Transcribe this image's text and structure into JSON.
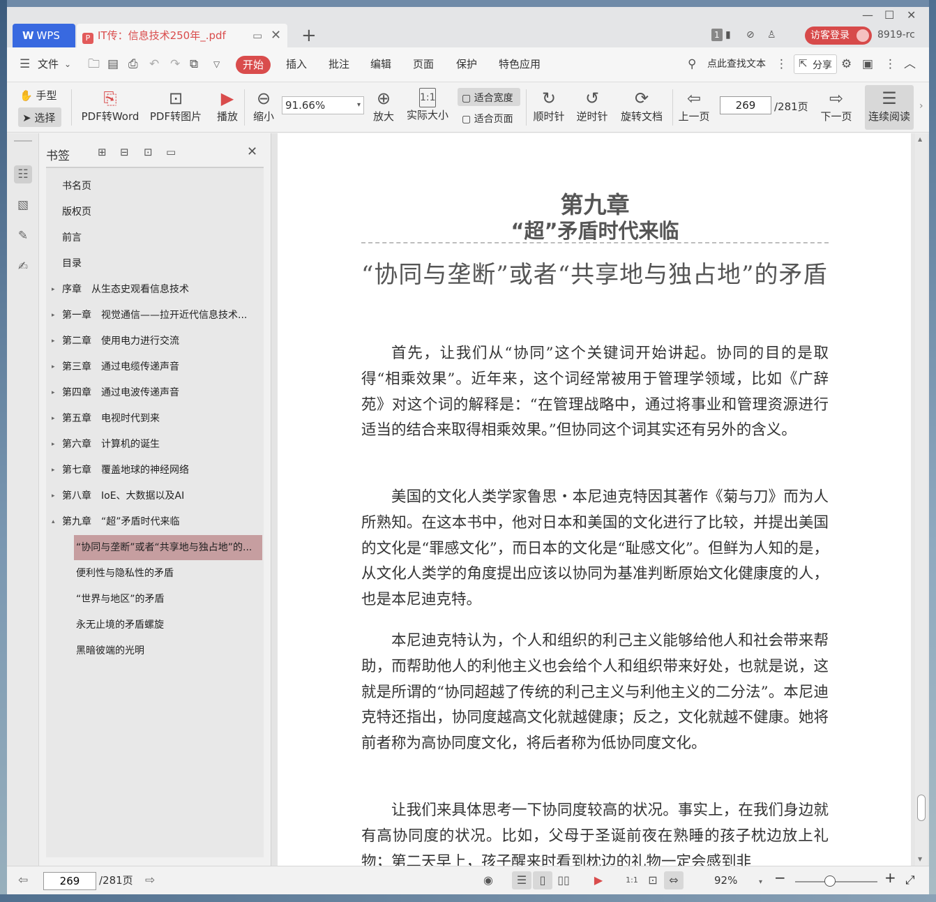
{
  "tabbar": {
    "app_label": "WPS",
    "doc_tab_title": "IT传：信息技术250年_.pdf",
    "page_badge": "1",
    "login_label": "访客登录",
    "user_label": "8919-rc"
  },
  "menubar": {
    "file_label": "文件",
    "tabs": [
      "开始",
      "插入",
      "批注",
      "编辑",
      "页面",
      "保护",
      "特色应用"
    ],
    "search_label": "点此查找文本",
    "share_label": "分享"
  },
  "toolbar": {
    "hand_label": "手型",
    "select_label": "选择",
    "pdf2word_label": "PDF转Word",
    "pdf2img_label": "PDF转图片",
    "play_label": "播放",
    "zoomout_label": "缩小",
    "zoom_value": "91.66%",
    "zoomin_label": "放大",
    "actual_label": "实际大小",
    "fitwidth_label": "适合宽度",
    "fitpage_label": "适合页面",
    "cw_label": "顺时针",
    "ccw_label": "逆时针",
    "rotate_label": "旋转文档",
    "prev_label": "上一页",
    "page_value": "269",
    "page_total": "/281页",
    "next_label": "下一页",
    "continuous_label": "连续阅读"
  },
  "bookmarks": {
    "title": "书签",
    "items": [
      {
        "label": "书名页",
        "caret": ""
      },
      {
        "label": "版权页",
        "caret": ""
      },
      {
        "label": "前言",
        "caret": ""
      },
      {
        "label": "目录",
        "caret": ""
      },
      {
        "label": "序章　从生态史观看信息技术",
        "caret": "▸"
      },
      {
        "label": "第一章　视觉通信——拉开近代信息技术...",
        "caret": "▸"
      },
      {
        "label": "第二章　使用电力进行交流",
        "caret": "▸"
      },
      {
        "label": "第三章　通过电缆传递声音",
        "caret": "▸"
      },
      {
        "label": "第四章　通过电波传递声音",
        "caret": "▸"
      },
      {
        "label": "第五章　电视时代到来",
        "caret": "▸"
      },
      {
        "label": "第六章　计算机的诞生",
        "caret": "▸"
      },
      {
        "label": "第七章　覆盖地球的神经网络",
        "caret": "▸"
      },
      {
        "label": "第八章　IoE、大数据以及AI",
        "caret": "▸"
      },
      {
        "label": "第九章　“超”矛盾时代来临",
        "caret": "▴"
      }
    ],
    "sub_items": [
      "“协同与垄断”或者“共享地与独占地”的...",
      "便利性与隐私性的矛盾",
      "“世界与地区”的矛盾",
      "永无止境的矛盾螺旋",
      "黑暗彼端的光明"
    ]
  },
  "document": {
    "chapter": "第九章",
    "chapter_title": "“超”矛盾时代来临",
    "section_title": "“协同与垄断”或者“共享地与独占地”的矛盾",
    "paragraphs": [
      "首先，让我们从“协同”这个关键词开始讲起。协同的目的是取得“相乘效果”。近年来，这个词经常被用于管理学领域，比如《广辞苑》对这个词的解释是：“在管理战略中，通过将事业和管理资源进行适当的结合来取得相乘效果。”但协同这个词其实还有另外的含义。",
      "美国的文化人类学家鲁思・本尼迪克特因其著作《菊与刀》而为人所熟知。在这本书中，他对日本和美国的文化进行了比较，并提出美国的文化是“罪感文化”，而日本的文化是“耻感文化”。但鲜为人知的是，从文化人类学的角度提出应该以协同为基准判断原始文化健康度的人，也是本尼迪克特。",
      "本尼迪克特认为，个人和组织的利己主义能够给他人和社会带来帮助，而帮助他人的利他主义也会给个人和组织带来好处，也就是说，这就是所谓的“协同超越了传统的利己主义与利他主义的二分法”。本尼迪克特还指出，协同度越高文化就越健康；反之，文化就越不健康。她将前者称为高协同度文化，将后者称为低协同度文化。",
      "让我们来具体思考一下协同度较高的状况。事实上，在我们身边就有高协同度的状况。比如，父母于圣诞前夜在熟睡的孩子枕边放上礼物；第二天早上，孩子醒来时看到枕边的礼物一定会感到非"
    ]
  },
  "statusbar": {
    "page_value": "269",
    "page_total": "/281页",
    "zoom": "92%"
  },
  "colors": {
    "accent": "#d94c4c",
    "wps_blue": "#3869e0",
    "selected_bookmark": "#c69ea0"
  }
}
